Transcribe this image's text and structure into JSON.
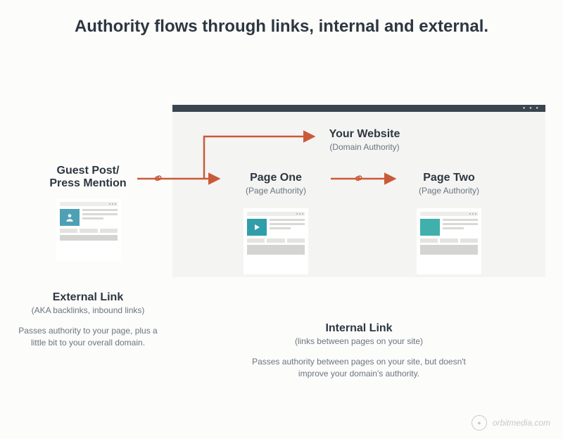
{
  "title": "Authority flows through links, internal and external.",
  "nodes": {
    "source": {
      "title": "Guest Post/\nPress Mention"
    },
    "website": {
      "title": "Your Website",
      "sub": "(Domain Authority)"
    },
    "page_one": {
      "title": "Page One",
      "sub": "(Page Authority)"
    },
    "page_two": {
      "title": "Page Two",
      "sub": "(Page Authority)"
    }
  },
  "sections": {
    "external": {
      "title": "External Link",
      "sub": "(AKA backlinks, inbound links)",
      "desc": "Passes authority to your page, plus a little bit to your overall domain."
    },
    "internal": {
      "title": "Internal Link",
      "sub": "(links between pages on your site)",
      "desc": "Passes authority between pages on your site, but doesn't improve your domain's authority."
    }
  },
  "colors": {
    "arrow": "#c95a39",
    "header_bar": "#3a4550",
    "source_thumb": "#4ea0b5",
    "page_one_thumb": "#2f9ea8",
    "page_two_thumb": "#3fb0ab"
  },
  "icons": {
    "source_thumb": "person-icon",
    "page_one_thumb": "play-icon",
    "page_two_thumb": "blank-icon",
    "link_chain": "link-chain-icon"
  },
  "footer": "orbitmedia.com"
}
